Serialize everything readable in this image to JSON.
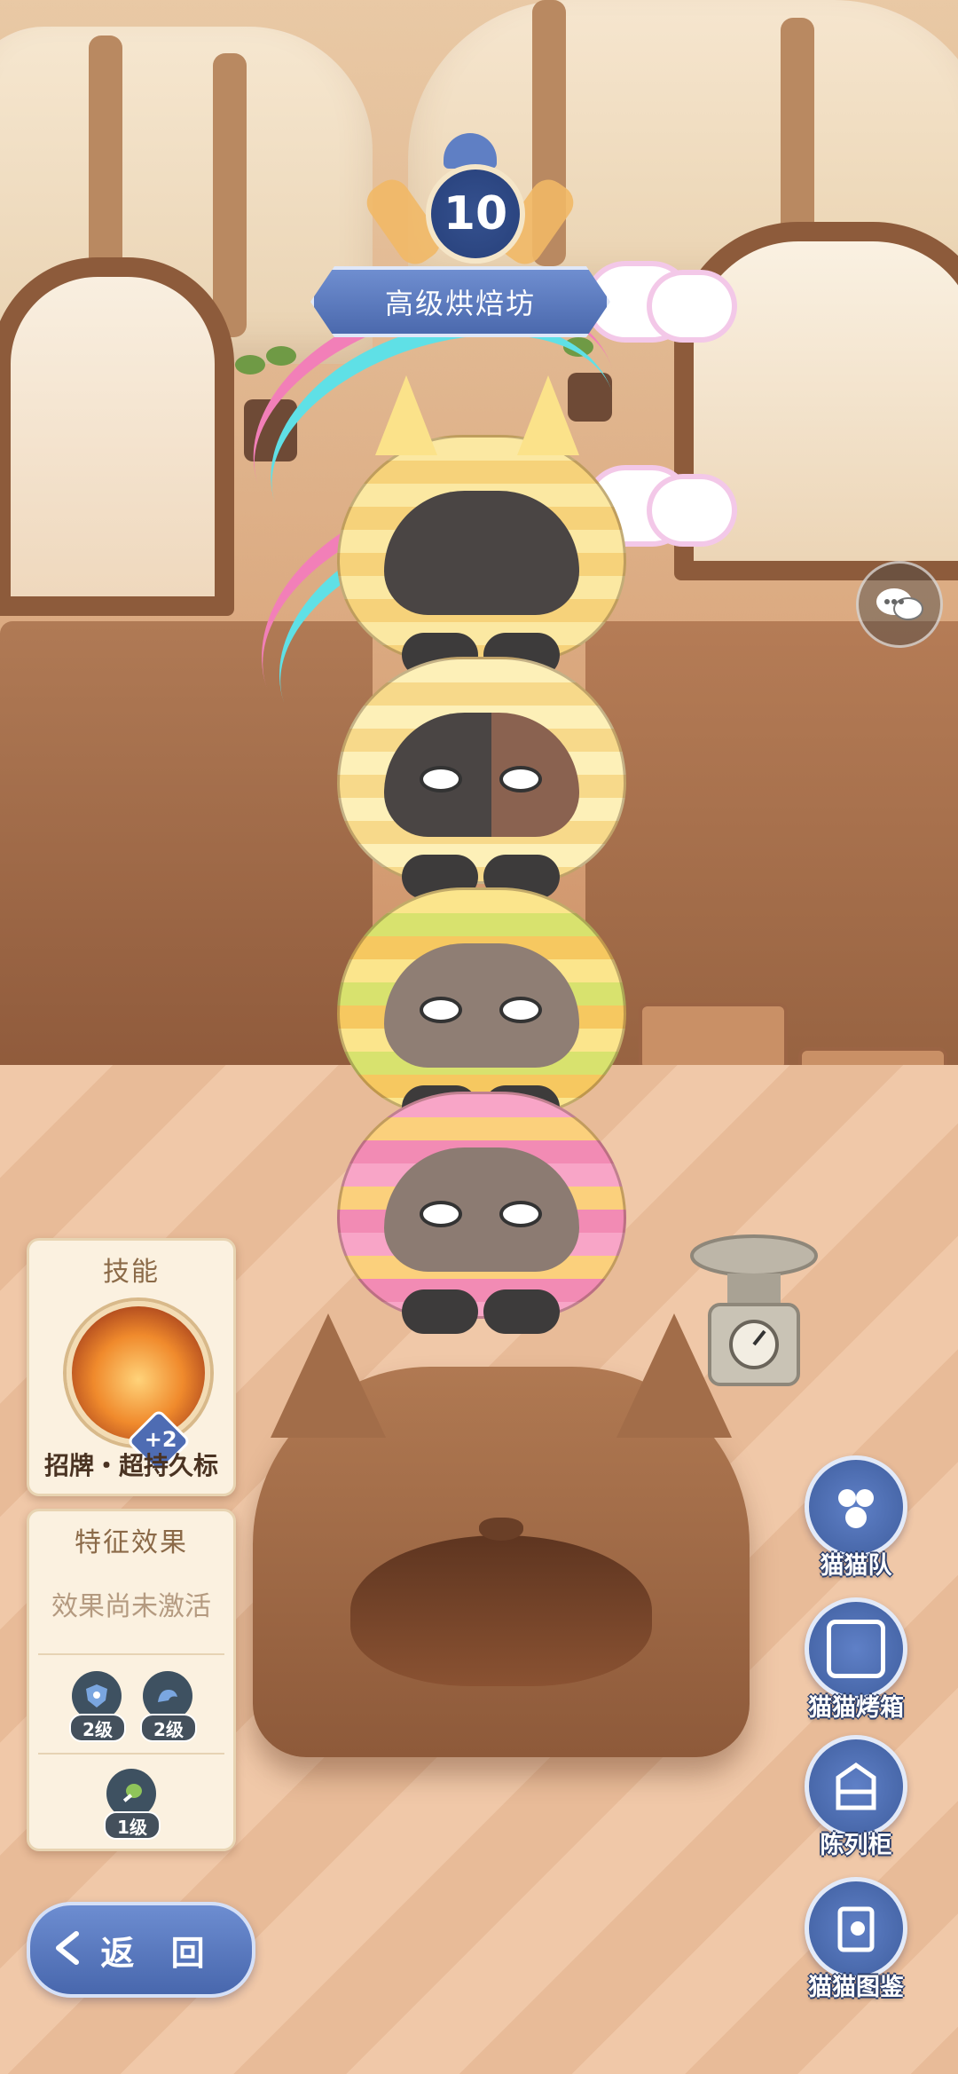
{
  "level_badge": {
    "level": "10",
    "rank_title": "高级烘焙坊"
  },
  "skill_panel": {
    "title": "技能",
    "skill_bonus": "+2",
    "skill_name": "招牌・超持久标"
  },
  "feature_panel": {
    "title": "特征效果",
    "status_text": "效果尚未激活",
    "trait_levels": [
      {
        "icon": "star-shield-icon",
        "level": "2级"
      },
      {
        "icon": "muscle-arm-icon",
        "level": "2级"
      },
      {
        "icon": "drumstick-icon",
        "level": "1级"
      }
    ]
  },
  "back_button": {
    "label": "返 回"
  },
  "right_menu": [
    {
      "icon": "cat-team-icon",
      "label": "猫猫队"
    },
    {
      "icon": "cat-oven-icon",
      "label": "猫猫烤箱"
    },
    {
      "icon": "display-cabinet-icon",
      "label": "陈列柜"
    },
    {
      "icon": "cat-encyclopedia-icon",
      "label": "猫猫图鉴"
    }
  ],
  "colors": {
    "accent_blue": "#4e6cb3",
    "panel_bg": "#fbf1e0",
    "label_stroke": "#2d3f6b"
  }
}
